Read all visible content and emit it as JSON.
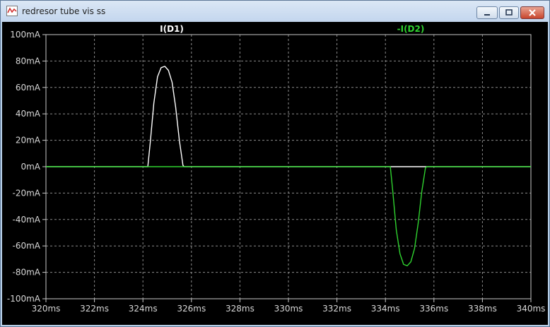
{
  "window": {
    "title": "redresor tube vis ss",
    "controls": {
      "minimize": "minimize",
      "maximize": "maximize",
      "close": "close"
    }
  },
  "chart_data": {
    "type": "line",
    "title": "",
    "xlabel": "",
    "ylabel": "",
    "xlim": [
      320,
      340
    ],
    "ylim": [
      -100,
      100
    ],
    "x_unit": "ms",
    "y_unit": "mA",
    "grid": true,
    "x_ticks": [
      "320ms",
      "322ms",
      "324ms",
      "326ms",
      "328ms",
      "330ms",
      "332ms",
      "334ms",
      "336ms",
      "338ms",
      "340ms"
    ],
    "y_ticks": [
      "100mA",
      "80mA",
      "60mA",
      "40mA",
      "20mA",
      "0mA",
      "-20mA",
      "-40mA",
      "-60mA",
      "-80mA",
      "-100mA"
    ],
    "series": [
      {
        "name": "I(D1)",
        "color": "#ffffff",
        "x": [
          320,
          324.2,
          324.3,
          324.45,
          324.6,
          324.75,
          324.9,
          325.05,
          325.2,
          325.35,
          325.5,
          325.65,
          325.7,
          336,
          336.2,
          340
        ],
        "y": [
          0,
          0,
          18,
          48,
          68,
          75,
          76,
          73,
          64,
          45,
          20,
          1,
          0,
          0,
          0,
          0
        ]
      },
      {
        "name": "-I(D2)",
        "color": "#2fd22f",
        "x": [
          320,
          334.2,
          334.3,
          334.45,
          334.6,
          334.75,
          334.9,
          335.05,
          335.2,
          335.35,
          335.5,
          335.65,
          335.7,
          340
        ],
        "y": [
          0,
          0,
          -18,
          -48,
          -66,
          -74,
          -75,
          -72,
          -62,
          -43,
          -19,
          -1,
          0,
          0
        ]
      }
    ]
  }
}
